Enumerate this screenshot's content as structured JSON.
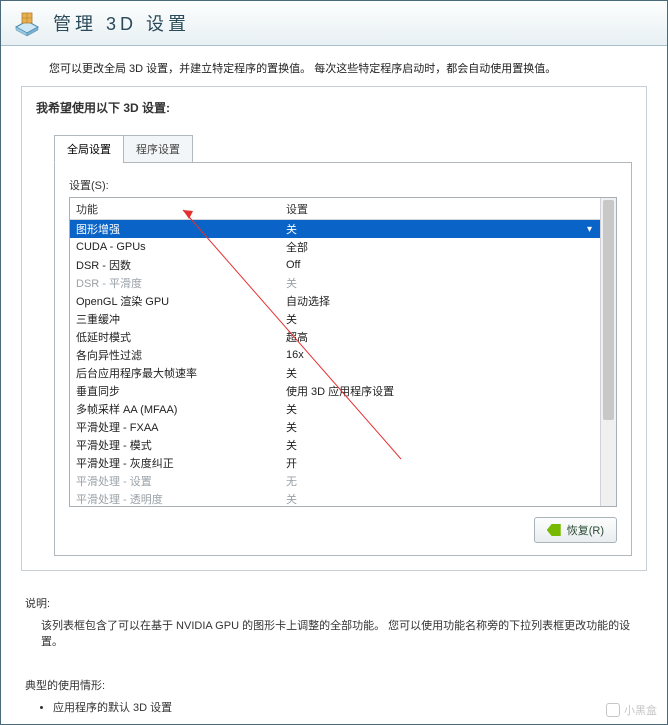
{
  "header": {
    "title": "管理 3D 设置"
  },
  "intro": "您可以更改全局 3D 设置，并建立特定程序的置换值。 每次这些特定程序启动时，都会自动使用置换值。",
  "panel": {
    "title": "我希望使用以下 3D 设置:",
    "tabs": {
      "global": "全局设置",
      "program": "程序设置"
    },
    "settings_label": "设置(S):",
    "columns": {
      "feature": "功能",
      "setting": "设置"
    },
    "rows": [
      {
        "name": "图形增强",
        "value": "关",
        "selected": true
      },
      {
        "name": "CUDA - GPUs",
        "value": "全部"
      },
      {
        "name": "DSR - 因数",
        "value": "Off"
      },
      {
        "name": "DSR - 平滑度",
        "value": "关",
        "disabled": true
      },
      {
        "name": "OpenGL 渲染 GPU",
        "value": "自动选择"
      },
      {
        "name": "三重缓冲",
        "value": "关"
      },
      {
        "name": "低延时模式",
        "value": "超高"
      },
      {
        "name": "各向异性过滤",
        "value": "16x"
      },
      {
        "name": "后台应用程序最大帧速率",
        "value": "关"
      },
      {
        "name": "垂直同步",
        "value": "使用 3D 应用程序设置"
      },
      {
        "name": "多帧采样 AA (MFAA)",
        "value": "关"
      },
      {
        "name": "平滑处理 - FXAA",
        "value": "关"
      },
      {
        "name": "平滑处理 - 模式",
        "value": "关"
      },
      {
        "name": "平滑处理 - 灰度纠正",
        "value": "开"
      },
      {
        "name": "平滑处理 - 设置",
        "value": "无",
        "disabled": true
      },
      {
        "name": "平滑处理 - 透明度",
        "value": "关",
        "disabled": true
      }
    ],
    "restore_label": "恢复(R)"
  },
  "description": {
    "label": "说明:",
    "text": "该列表框包含了可以在基于 NVIDIA GPU 的图形卡上调整的全部功能。 您可以使用功能名称旁的下拉列表框更改功能的设置。"
  },
  "typical": {
    "label": "典型的使用情形:",
    "items": [
      "应用程序的默认 3D 设置"
    ]
  },
  "watermark": "小黑盒"
}
